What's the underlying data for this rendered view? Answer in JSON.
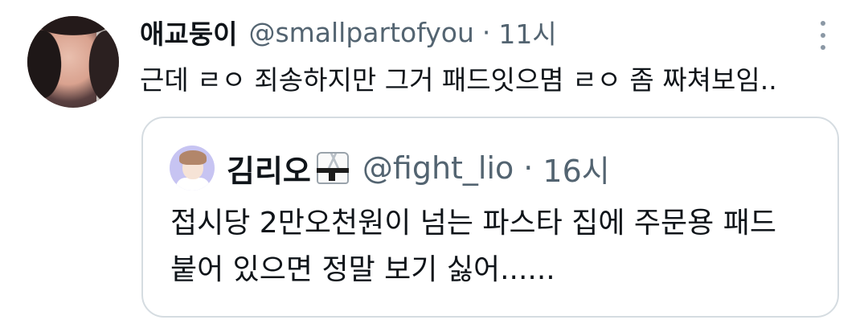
{
  "tweet": {
    "display_name": "애교둥이",
    "handle": "@smallpartofyou",
    "separator": "·",
    "time": "11시",
    "text": "근데 ㄹㅇ 죄송하지만 그거 패드잇으몀 ㄹㅇ 좀 짜쳐보임.."
  },
  "quoted_tweet": {
    "display_name": "김리오",
    "name_emoji": "martial-arts-uniform-icon",
    "handle": "@fight_lio",
    "separator": "·",
    "time": "16시",
    "text_line_1": "접시당 2만오천원이 넘는 파스타 집에 주문용 패드",
    "text_line_2": "붙어 있으면 정말 보기 싫어......"
  },
  "colors": {
    "primary_text": "#0f1419",
    "secondary_text": "#536471",
    "border": "#d5dce1",
    "quote_avatar_bg": "#c7c4f2"
  }
}
